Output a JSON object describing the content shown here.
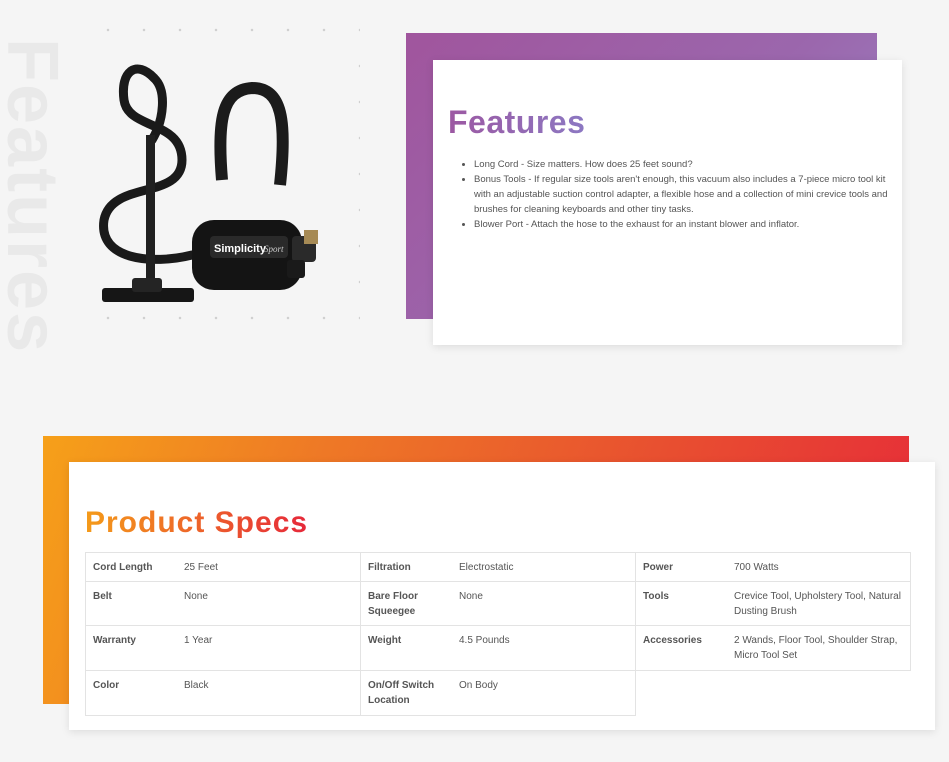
{
  "background_word": "Features",
  "product_image": {
    "brand_text": "Simplicity",
    "model_text": "Sport"
  },
  "features": {
    "title": "Features",
    "items": [
      "Long Cord - Size matters. How does 25 feet sound?",
      "Bonus Tools - If regular size tools aren't enough, this vacuum also includes a 7-piece micro tool kit with an adjustable suction control adapter, a flexible hose and a collection of mini crevice tools and brushes for cleaning keyboards and other tiny tasks.",
      "Blower Port - Attach the hose to the exhaust for an instant blower and inflator."
    ]
  },
  "specs": {
    "title": "Product Specs",
    "cells": [
      {
        "label": "Cord Length",
        "value": "25 Feet"
      },
      {
        "label": "Filtration",
        "value": "Electrostatic"
      },
      {
        "label": "Power",
        "value": "700 Watts"
      },
      {
        "label": "Belt",
        "value": "None"
      },
      {
        "label": "Bare Floor Squeegee",
        "value": "None"
      },
      {
        "label": "Tools",
        "value": "Crevice Tool, Upholstery Tool, Natural Dusting Brush"
      },
      {
        "label": "Warranty",
        "value": "1 Year"
      },
      {
        "label": "Weight",
        "value": "4.5 Pounds"
      },
      {
        "label": "Accessories",
        "value": "2 Wands, Floor Tool, Shoulder Strap, Micro Tool Set"
      },
      {
        "label": "Color",
        "value": "Black"
      },
      {
        "label": "On/Off Switch Location",
        "value": "On Body"
      }
    ]
  },
  "colors": {
    "features_gradient_start": "#a0559d",
    "features_gradient_end": "#9b8ac8",
    "specs_gradient_start": "#f6a019",
    "specs_gradient_end": "#e6283a"
  }
}
